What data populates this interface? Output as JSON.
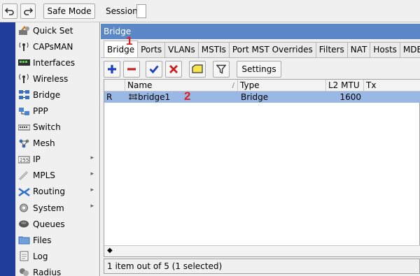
{
  "topbar": {
    "undo_icon": "undo-icon",
    "redo_icon": "redo-icon",
    "safe_mode_label": "Safe Mode",
    "session_label": "Session:"
  },
  "sidebar": {
    "items": [
      {
        "label": "Quick Set",
        "icon": "quick-set-icon",
        "submenu": false
      },
      {
        "label": "CAPsMAN",
        "icon": "capsman-icon",
        "submenu": false
      },
      {
        "label": "Interfaces",
        "icon": "interfaces-icon",
        "submenu": false
      },
      {
        "label": "Wireless",
        "icon": "wireless-icon",
        "submenu": false
      },
      {
        "label": "Bridge",
        "icon": "bridge-icon",
        "submenu": false
      },
      {
        "label": "PPP",
        "icon": "ppp-icon",
        "submenu": false
      },
      {
        "label": "Switch",
        "icon": "switch-icon",
        "submenu": false
      },
      {
        "label": "Mesh",
        "icon": "mesh-icon",
        "submenu": false
      },
      {
        "label": "IP",
        "icon": "ip-icon",
        "submenu": true
      },
      {
        "label": "MPLS",
        "icon": "mpls-icon",
        "submenu": true
      },
      {
        "label": "Routing",
        "icon": "routing-icon",
        "submenu": true
      },
      {
        "label": "System",
        "icon": "system-icon",
        "submenu": true
      },
      {
        "label": "Queues",
        "icon": "queues-icon",
        "submenu": false
      },
      {
        "label": "Files",
        "icon": "files-icon",
        "submenu": false
      },
      {
        "label": "Log",
        "icon": "log-icon",
        "submenu": false
      },
      {
        "label": "Radius",
        "icon": "radius-icon",
        "submenu": false
      }
    ]
  },
  "window": {
    "title": "Bridge",
    "tabs": [
      "Bridge",
      "Ports",
      "VLANs",
      "MSTIs",
      "Port MST Overrides",
      "Filters",
      "NAT",
      "Hosts",
      "MDB"
    ],
    "active_tab": "Bridge",
    "toolbar": {
      "settings_label": "Settings"
    },
    "table": {
      "columns": [
        "Name",
        "Type",
        "L2 MTU",
        "Tx"
      ],
      "rows": [
        {
          "flag": "R",
          "name": "bridge1",
          "type": "Bridge",
          "l2mtu": "1600",
          "tx": "",
          "selected": true
        }
      ]
    },
    "status": "1 item out of 5 (1 selected)"
  },
  "annotations": {
    "marker1": "1",
    "marker2": "2"
  },
  "colors": {
    "sidebar_strip": "#213d9c",
    "title_bar": "#5c88c7",
    "selected_row": "#9ab8e6",
    "annotation": "#e02020"
  }
}
